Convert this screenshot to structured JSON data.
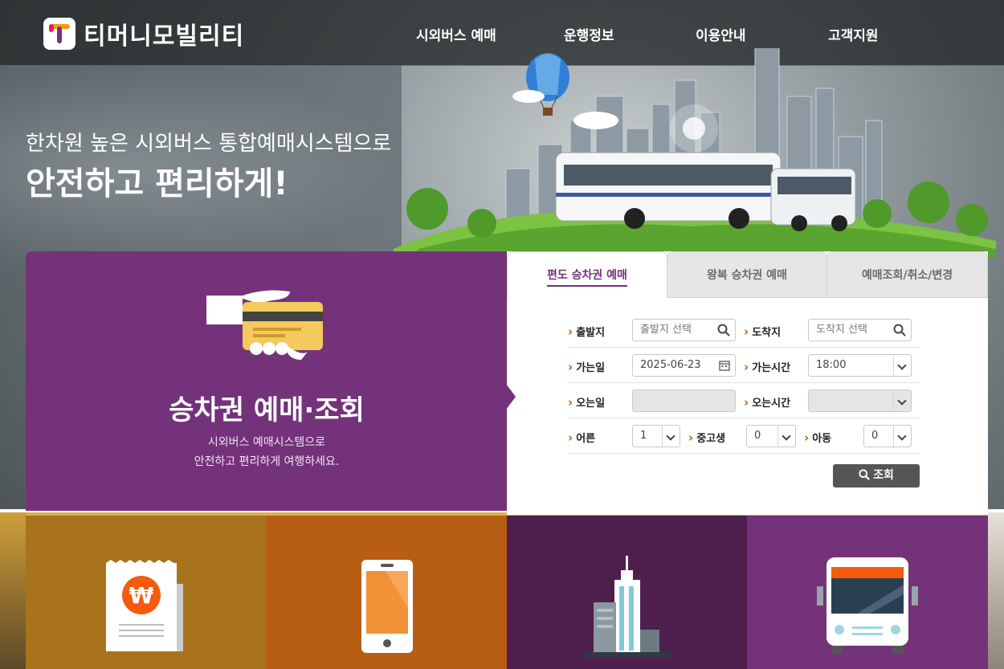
{
  "header": {
    "logo_text": "티머니모빌리티",
    "nav": [
      {
        "label": "시외버스 예매"
      },
      {
        "label": "운행정보"
      },
      {
        "label": "이용안내"
      },
      {
        "label": "고객지원"
      }
    ]
  },
  "hero": {
    "subtitle": "한차원 높은 시외버스 통합예매시스템으로",
    "title": "안전하고 편리하게!"
  },
  "promo_card": {
    "title": "승차권 예매·조회",
    "desc_line1": "시외버스 예매시스템으로",
    "desc_line2": "안전하고 편리하게 여행하세요.",
    "icon": "hand-card-icon"
  },
  "booking": {
    "tabs": [
      {
        "label": "편도 승차권 예매",
        "active": true
      },
      {
        "label": "왕복 승차권 예매",
        "active": false
      },
      {
        "label": "예매조회/취소/변경",
        "active": false
      }
    ],
    "departure_label": "출발지",
    "departure_placeholder": "출발지 선택",
    "arrival_label": "도착지",
    "arrival_placeholder": "도착지 선택",
    "go_date_label": "가는일",
    "go_date_value": "2025-06-23",
    "go_time_label": "가는시간",
    "go_time_value": "18:00",
    "return_date_label": "오는일",
    "return_time_label": "오는시간",
    "adult_label": "어른",
    "adult_value": "1",
    "student_label": "중고생",
    "student_value": "0",
    "child_label": "아동",
    "child_value": "0",
    "search_label": "조회"
  },
  "tiles": [
    {
      "color": "#a8731c",
      "icon": "receipt-won-icon"
    },
    {
      "color": "#b85e14",
      "icon": "smartphone-icon"
    },
    {
      "color": "#4e1f4d",
      "icon": "building-icon"
    },
    {
      "color": "#74327a",
      "icon": "bus-front-icon"
    }
  ],
  "colors": {
    "brand_purple": "#74327a",
    "accent_orange": "#d35400"
  }
}
